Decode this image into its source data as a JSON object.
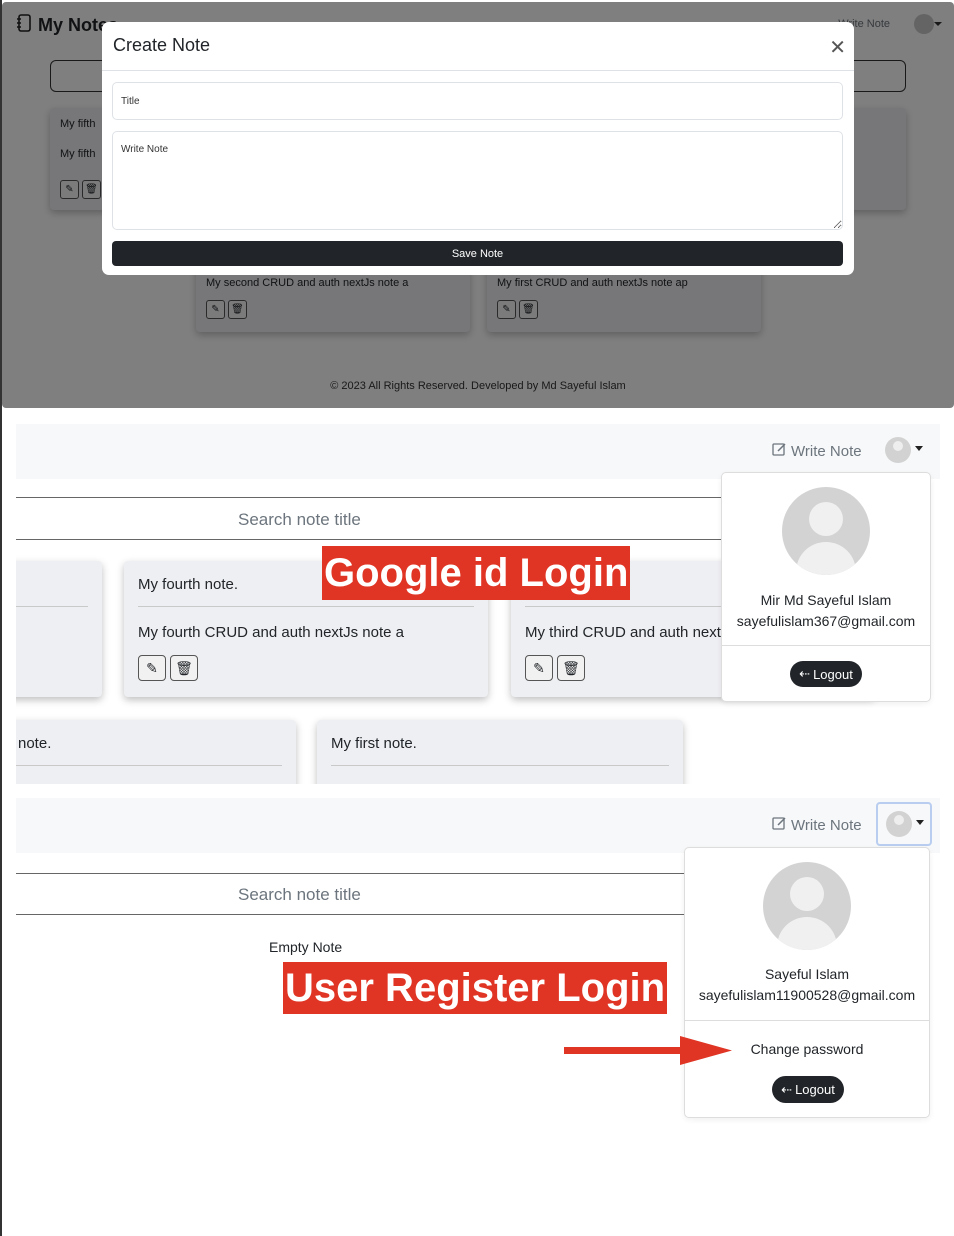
{
  "panel1": {
    "brand": "My Notes",
    "nav_write": "Write Note",
    "cards": [
      {
        "title": "My fifth",
        "body": "My fifth"
      },
      {
        "body": "My second CRUD and auth nextJs note a"
      },
      {
        "body": "My first CRUD and auth nextJs note ap"
      }
    ],
    "footer": "© 2023 All Rights Reserved. Developed by Md Sayeful Islam",
    "modal": {
      "title": "Create Note",
      "title_placeholder": "Title",
      "note_placeholder": "Write Note",
      "save_label": "Save Note"
    }
  },
  "panel2": {
    "nav_write": "Write Note",
    "search_placeholder": "Search note title",
    "overlay_label": "Google id Login",
    "cards": [
      {
        "title": "My fourth note.",
        "body": "My fourth CRUD and auth nextJs note a"
      },
      {
        "title": "",
        "body": "My third CRUD and auth nextJs"
      },
      {
        "title": "note."
      },
      {
        "title": "My first note."
      }
    ],
    "dropdown": {
      "name": "Mir Md Sayeful Islam",
      "email": "sayefulislam367@gmail.com",
      "logout_label": "Logout"
    }
  },
  "panel3": {
    "nav_write": "Write Note",
    "search_placeholder": "Search note title",
    "empty_text": "Empty Note",
    "overlay_label": "User Register Login",
    "dropdown": {
      "name": "Sayeful Islam",
      "email": "sayefulislam11900528@gmail.com",
      "change_password": "Change password",
      "logout_label": "Logout"
    }
  },
  "colors": {
    "label_bg": "#e03524",
    "dark_button": "#212529",
    "arrow": "#e03524"
  }
}
